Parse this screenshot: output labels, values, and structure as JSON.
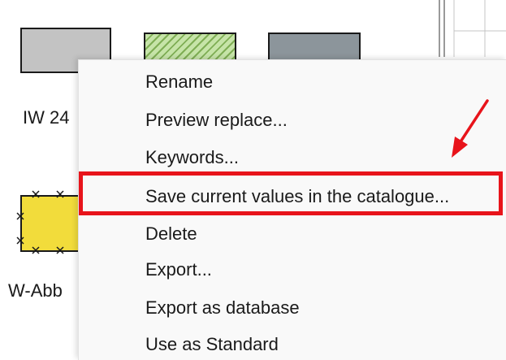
{
  "swatches": {
    "items": [
      {
        "name": "gray-swatch",
        "color": "#c3c3c3",
        "label": "IW 24"
      },
      {
        "name": "hatch-swatch",
        "color": "#c6e4a8"
      },
      {
        "name": "dark-swatch",
        "color": "#8c959b"
      },
      {
        "name": "yellow-swatch",
        "color": "#f2dc3b",
        "label": "W-Abb"
      }
    ]
  },
  "context_menu": {
    "items": [
      {
        "label": "Rename"
      },
      {
        "label": "Preview replace..."
      },
      {
        "label": "Keywords..."
      },
      {
        "label": "Save current values in the catalogue...",
        "highlighted": true
      },
      {
        "label": "Delete"
      },
      {
        "label": "Export..."
      },
      {
        "label": "Export as database"
      },
      {
        "label": "Use as Standard"
      }
    ]
  },
  "annotation": {
    "color": "#e8141b",
    "arrow_icon": "red-arrow-icon"
  }
}
